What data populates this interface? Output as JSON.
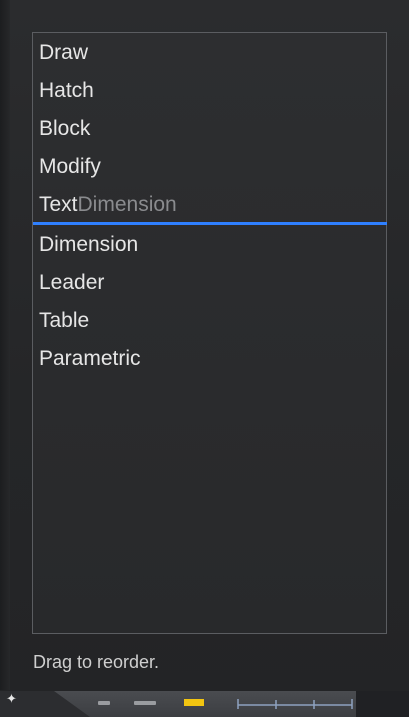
{
  "list": {
    "items": [
      {
        "label": "Draw"
      },
      {
        "label": "Hatch"
      },
      {
        "label": "Block"
      },
      {
        "label": "Modify"
      },
      {
        "label": "Text",
        "ghost": "Dimension"
      },
      {
        "label": "Dimension"
      },
      {
        "label": "Leader"
      },
      {
        "label": "Table"
      },
      {
        "label": "Parametric"
      }
    ]
  },
  "hint": "Drag to reorder.",
  "colors": {
    "background": "#262729",
    "text": "#e6e6e6",
    "ghost_text": "#8a8b8e",
    "drop_indicator": "#2f80ff",
    "border": "#5b5d61"
  },
  "icons": {
    "bottom_left": "plus-icon",
    "toolbar_yellow": "yellow-toolbar-icon",
    "toolbar_ruler": "ruler-icon"
  }
}
